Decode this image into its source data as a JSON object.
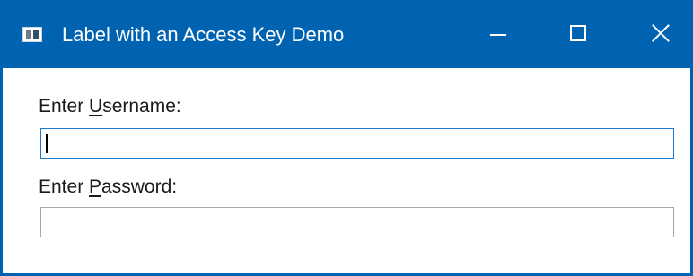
{
  "window": {
    "title": "Label with an Access Key Demo",
    "icon": "app-window-icon",
    "accent_color": "#0063b1",
    "controls": [
      "minimize-icon",
      "maximize-icon",
      "close-icon"
    ]
  },
  "form": {
    "username_label_prefix": "Enter ",
    "username_label_access_key": "U",
    "username_label_suffix": "sername:",
    "username_value": "",
    "password_label_prefix": "Enter ",
    "password_label_access_key": "P",
    "password_label_suffix": "assword:",
    "password_value": ""
  }
}
